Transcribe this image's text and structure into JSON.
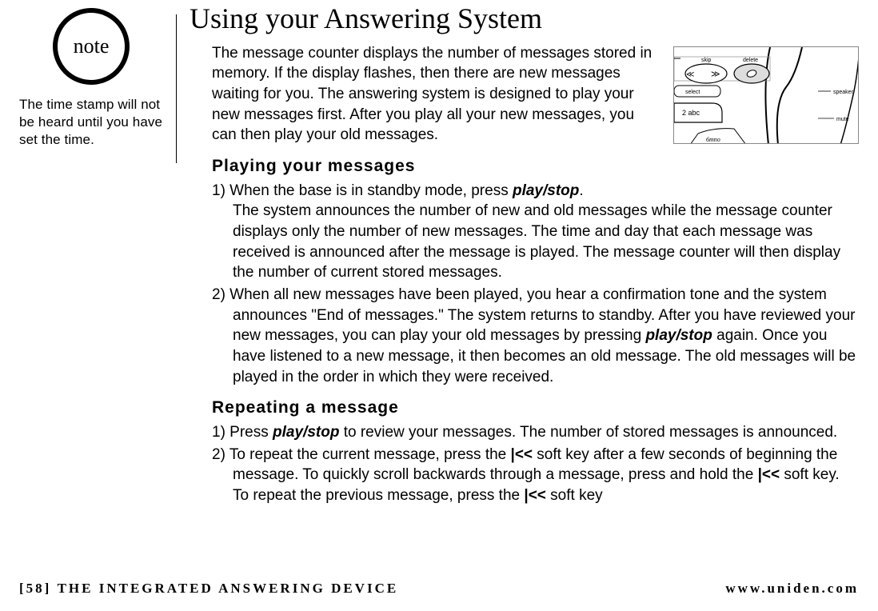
{
  "note": {
    "badge_label": "note",
    "sidebar_text": "The time stamp will not be heard until you have set the time."
  },
  "title": "Using your Answering System",
  "intro": "The message counter displays the number of messages stored in memory. If the display flashes, then there are new messages waiting for you. The answering system is designed to play your new messages first. After you play all your new messages, you can then play your old messages.",
  "illustration": {
    "labels": {
      "skip": "skip",
      "delete": "delete",
      "speaker": "speaker",
      "mute": "mute",
      "select": "select",
      "key2": "2 abc"
    }
  },
  "sections": {
    "playing": {
      "heading": "Playing your messages",
      "item1_pre": "1) When the base is in standby mode, press ",
      "item1_key": "play/stop",
      "item1_post": ".",
      "item1_body": "The system announces the number of new and old messages while the message counter displays only the number of new messages. The time and day that each message was received is announced after the message is played. The message counter will then display the number of current stored messages.",
      "item2_pre": "2) When all new messages have been played, you hear a confirmation tone and the system announces \"End of messages.\" The system returns to standby. After you have reviewed your new messages, you can play your old messages by pressing ",
      "item2_key": "play/stop",
      "item2_post": " again. Once you have listened to a new message, it then becomes an old message. The old messages will be played in the order in which they were received."
    },
    "repeating": {
      "heading": "Repeating a message",
      "item1_pre": "1) Press ",
      "item1_key": "play/stop",
      "item1_post": " to review your messages. The number of stored messages is announced.",
      "item2_a": "2) To repeat the current message, press the ",
      "rw1": "|<<",
      "item2_b": " soft key after a few seconds of beginning the message. To quickly scroll backwards through a message, press and hold the ",
      "rw2": "|<<",
      "item2_c": " soft key. To repeat the previous message, press the ",
      "rw3": "|<<",
      "item2_d": " soft key"
    }
  },
  "footer": {
    "page_num": "[58]",
    "section_name": "THE INTEGRATED ANSWERING DEVICE",
    "url": "www.uniden.com"
  }
}
